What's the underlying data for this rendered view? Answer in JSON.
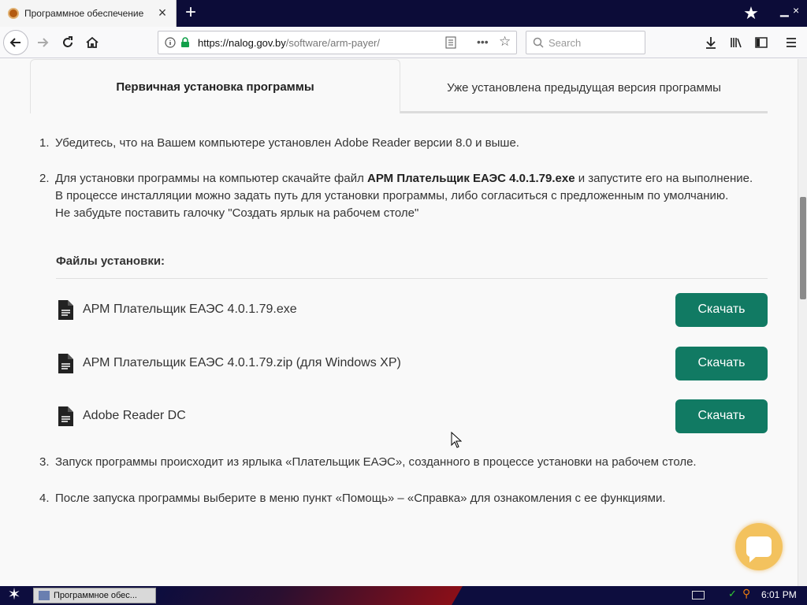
{
  "browser": {
    "tab_title": "Программное обеспечение",
    "url_host": "https://nalog.gov.by",
    "url_path": "/software/arm-payer/",
    "search_placeholder": "Search"
  },
  "tabs": {
    "active_label": "Первичная установка программы",
    "inactive_label": "Уже установлена предыдущая версия программы"
  },
  "steps": [
    {
      "num": "1.",
      "text": "Убедитесь, что на Вашем компьютере установлен Adobe Reader версии 8.0 и выше."
    },
    {
      "num": "2.",
      "prefix": "Для установки программы на компьютер скачайте файл ",
      "bold": "АРМ Плательщик ЕАЭС 4.0.1.79.exe",
      "suffix": " и запустите его на выполнение.",
      "line2": "В процессе инсталляции можно задать путь для установки программы, либо согласиться с предложенным по умолчанию.",
      "line3": "Не забудьте поставить галочку \"Создать ярлык на рабочем столе\""
    },
    {
      "num": "3.",
      "text": "Запуск программы происходит из ярлыка «Плательщик ЕАЭС», созданного в процессе установки на рабочем столе."
    },
    {
      "num": "4.",
      "text": "После запуска программы выберите в меню пункт «Помощь» – «Справка» для ознакомления с ее функциями."
    }
  ],
  "files": {
    "heading": "Файлы установки:",
    "items": [
      {
        "name": "АРМ Плательщик ЕАЭС 4.0.1.79.exe",
        "button": "Скачать"
      },
      {
        "name": "АРМ Плательщик ЕАЭС 4.0.1.79.zip (для Windows XP)",
        "button": "Скачать"
      },
      {
        "name": "Adobe Reader DC",
        "button": "Скачать"
      }
    ]
  },
  "taskbar": {
    "task_label": "Программное обес...",
    "clock": "6:01 PM"
  },
  "colors": {
    "download_button": "#117a63",
    "chat_button": "#f3c25e",
    "tabstrip": "#0c0c38"
  }
}
